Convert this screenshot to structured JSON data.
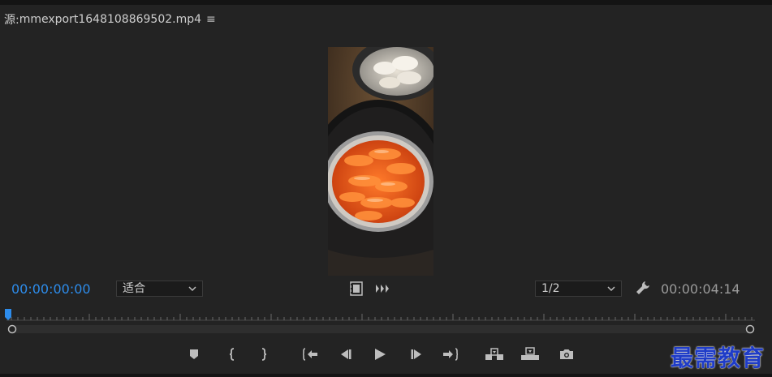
{
  "source_panel": {
    "tab_prefix": "源:",
    "clip_name": "mmexport1648108869502.mp4",
    "menu_icon": "hamburger-icon"
  },
  "timecode": {
    "current": "00:00:00:00",
    "duration": "00:00:04:14",
    "current_color": "#2d8ceb"
  },
  "zoom_select": {
    "value": "适合"
  },
  "resolution_select": {
    "value": "1/2"
  },
  "playhead_color": "#2d8ceb",
  "transport_icons": [
    "add-marker-icon",
    "mark-in-icon",
    "mark-out-icon",
    "go-to-in-icon",
    "step-back-icon",
    "play-icon",
    "step-forward-icon",
    "go-to-out-icon",
    "insert-icon",
    "overwrite-icon",
    "export-frame-icon"
  ],
  "watermark_text": "最需教育"
}
